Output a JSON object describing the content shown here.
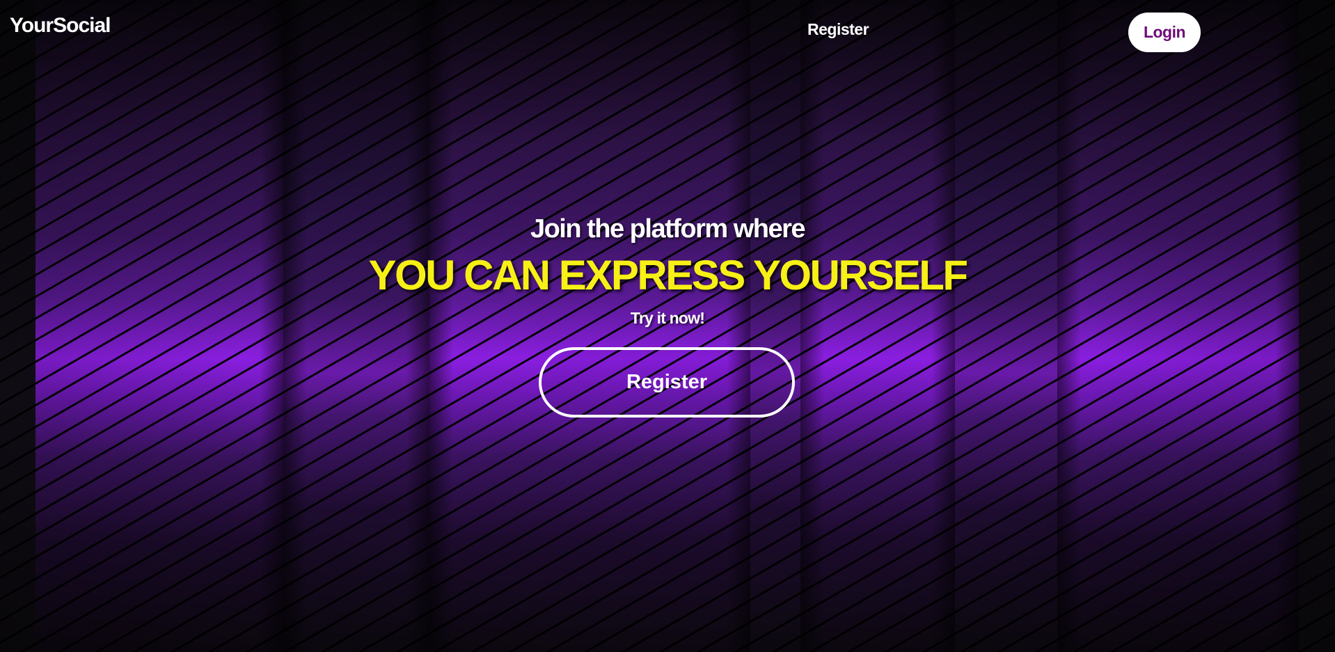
{
  "header": {
    "brand": "YourSocial",
    "register_link": "Register",
    "login_button": "Login"
  },
  "hero": {
    "pretitle": "Join the platform where",
    "title": "YOU CAN EXPRESS YOURSELF",
    "subtitle": "Try it now!",
    "cta_button": "Register"
  },
  "colors": {
    "title_yellow": "#f7f016",
    "login_text_purple": "#6d0c78",
    "accent_violet": "#8a1ee0",
    "background_black": "#0b0a0d"
  }
}
